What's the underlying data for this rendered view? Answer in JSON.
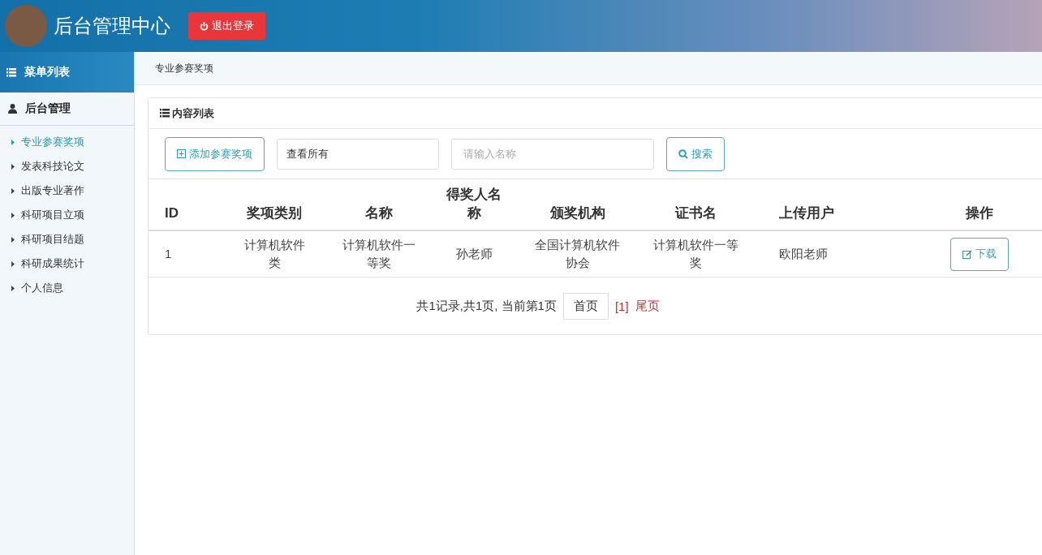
{
  "header": {
    "title": "后台管理中心",
    "logout_button": "退出登录"
  },
  "sidebar": {
    "title": "菜单列表",
    "section": "后台管理",
    "items": [
      {
        "label": "专业参赛奖项",
        "selected": true
      },
      {
        "label": "发表科技论文",
        "selected": false
      },
      {
        "label": "出版专业著作",
        "selected": false
      },
      {
        "label": "科研项目立项",
        "selected": false
      },
      {
        "label": "科研项目结题",
        "selected": false
      },
      {
        "label": "科研成果统计",
        "selected": false
      },
      {
        "label": "个人信息",
        "selected": false
      }
    ]
  },
  "breadcrumb": "专业参赛奖项",
  "panel": {
    "title": "内容列表",
    "add_button": "添加参赛奖项",
    "filter": {
      "value": "查看所有"
    },
    "search": {
      "placeholder": "请输入名称"
    },
    "search_button": "搜索"
  },
  "table": {
    "columns": [
      "ID",
      "奖项类别",
      "名称",
      "得奖人名称",
      "颁奖机构",
      "证书名",
      "上传用户",
      "操作"
    ],
    "rows": [
      {
        "cells": [
          "1",
          "计算机软件类",
          "计算机软件一等奖",
          "孙老师",
          "全国计算机软件协会",
          "计算机软件一等奖",
          "欧阳老师"
        ],
        "action": "下载"
      }
    ]
  },
  "pagination": {
    "summary": "共1记录,共1页, 当前第1页",
    "first": "首页",
    "current": "[1]",
    "last": "尾页"
  }
}
